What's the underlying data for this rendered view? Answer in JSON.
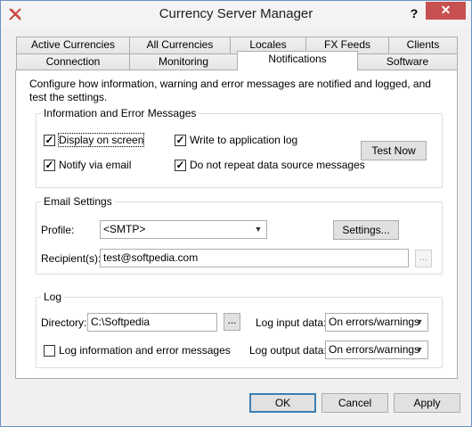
{
  "window": {
    "title": "Currency Server Manager",
    "help_label": "?",
    "close_label": "✕"
  },
  "tabs": {
    "row_back": [
      "Active Currencies",
      "All Currencies",
      "Locales",
      "FX Feeds",
      "Clients"
    ],
    "row_front": [
      "Connection",
      "Monitoring",
      "Notifications",
      "Software"
    ],
    "active": "Notifications"
  },
  "panel": {
    "description": "Configure how information, warning and error messages are notified and logged, and test the settings.",
    "info_group": {
      "title": "Information and Error Messages",
      "display_on_screen": "Display on screen",
      "notify_via_email": "Notify via email",
      "write_to_log": "Write to application log",
      "no_repeat": "Do not repeat data source messages",
      "test_now": "Test Now"
    },
    "email_group": {
      "title": "Email Settings",
      "profile_label": "Profile:",
      "profile_value": "<SMTP>",
      "settings_button": "Settings...",
      "recipients_label": "Recipient(s):",
      "recipients_value": "test@softpedia.com",
      "browse": "..."
    },
    "log_group": {
      "title": "Log",
      "directory_label": "Directory:",
      "directory_value": "C:\\Softpedia",
      "browse": "...",
      "log_messages": "Log information and error messages",
      "input_label": "Log input data:",
      "input_value": "On errors/warnings",
      "output_label": "Log output data:",
      "output_value": "On errors/warnings"
    }
  },
  "footer": {
    "ok": "OK",
    "cancel": "Cancel",
    "apply": "Apply"
  }
}
